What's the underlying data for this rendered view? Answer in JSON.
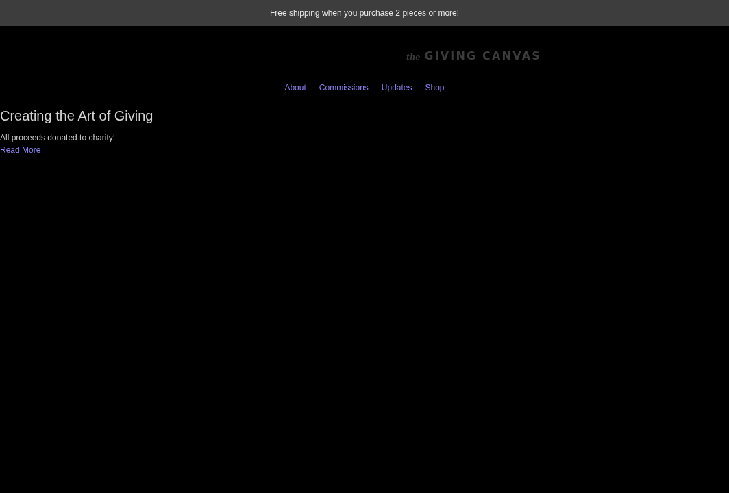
{
  "announcement_bar": {
    "text": "Free shipping when you purchase 2 pieces or more!"
  },
  "logo": {
    "prefix": "the",
    "name": "GIVING CANVAS"
  },
  "nav": {
    "links": [
      "About",
      "Commissions",
      "Updates",
      "Shop"
    ]
  },
  "hero": {
    "title": "Creating the Art of Giving",
    "subtitle": "All proceeds donated to charity!",
    "link": "Read More"
  }
}
